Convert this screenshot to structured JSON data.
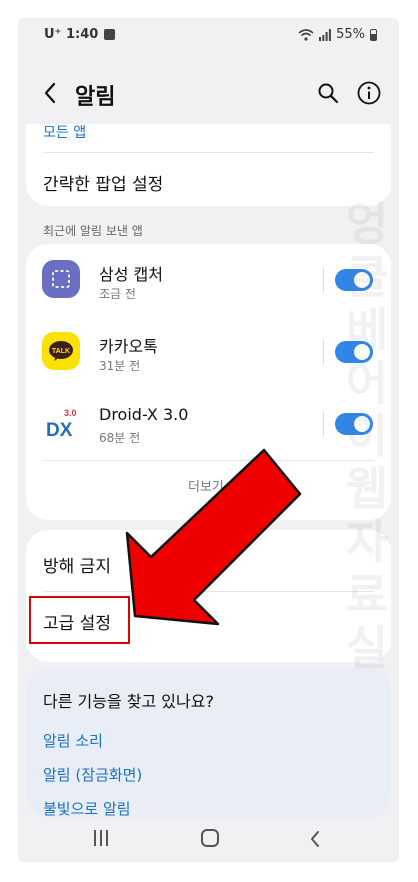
{
  "status_bar": {
    "carrier": "U⁺ 1:40",
    "battery": "55%"
  },
  "header": {
    "title": "알림"
  },
  "top_card": {
    "partial_link": "모든 앱",
    "popup_setting": "간략한 팝업 설정"
  },
  "recent": {
    "section_label": "최근에 알림 보낸 앱",
    "apps": [
      {
        "name": "삼성 캡처",
        "sub": "조금 전",
        "enabled": true,
        "icon": "samsung-capture-icon",
        "icon_color": "#6b6fc4"
      },
      {
        "name": "카카오톡",
        "sub": "31분 전",
        "enabled": true,
        "icon": "kakaotalk-icon",
        "icon_color": "#fbe200"
      },
      {
        "name": "Droid-X 3.0",
        "sub": "68분 전",
        "enabled": true,
        "icon": "droid-x-icon",
        "icon_color": "#ffffff"
      }
    ],
    "more_label": "더보기"
  },
  "settings": {
    "dnd": "방해 금지",
    "advanced": "고급 설정"
  },
  "suggest": {
    "title": "다른 기능을 찾고 있나요?",
    "links": [
      "알림 소리",
      "알림 (잠금화면)",
      "불빛으로 알림"
    ]
  },
  "watermark": "엉클베어이웹자료실",
  "colors": {
    "accent": "#2f86e6",
    "link": "#1a6fc7",
    "highlight": "#e00000"
  }
}
